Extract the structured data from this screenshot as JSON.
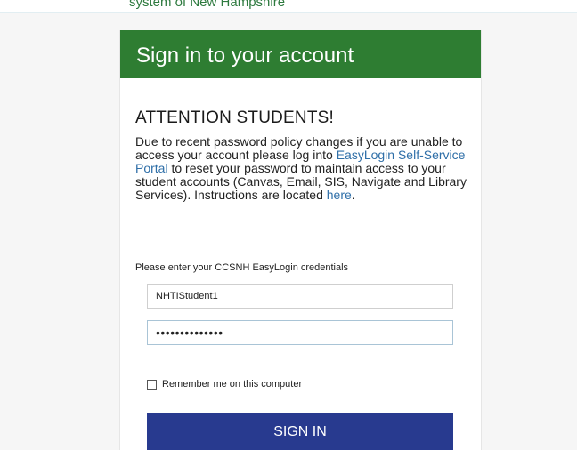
{
  "top_banner": {
    "text": "system of New Hampshire"
  },
  "card": {
    "title": "Sign in to your account",
    "attention": {
      "heading": "ATTENTION STUDENTS!",
      "text_before_link": "Due to recent password policy changes if you are unable to access your account please log into ",
      "portal_link": "EasyLogin Self-Service Portal",
      "text_after_link": " to reset your password to maintain access to your student accounts (Canvas, Email, SIS, Navigate and Library Services). Instructions are located ",
      "here_link": "here",
      "text_end": "."
    },
    "credentials_label": "Please enter your CCSNH EasyLogin credentials",
    "username_value": "NHTIStudent1",
    "password_value": "••••••••••••••",
    "remember_label": "Remember me on this computer",
    "remember_checked": false,
    "signin_label": "SIGN IN"
  },
  "colors": {
    "header_green": "#2e7d32",
    "button_navy": "#283a8f",
    "link_blue": "#2f6fa8"
  }
}
